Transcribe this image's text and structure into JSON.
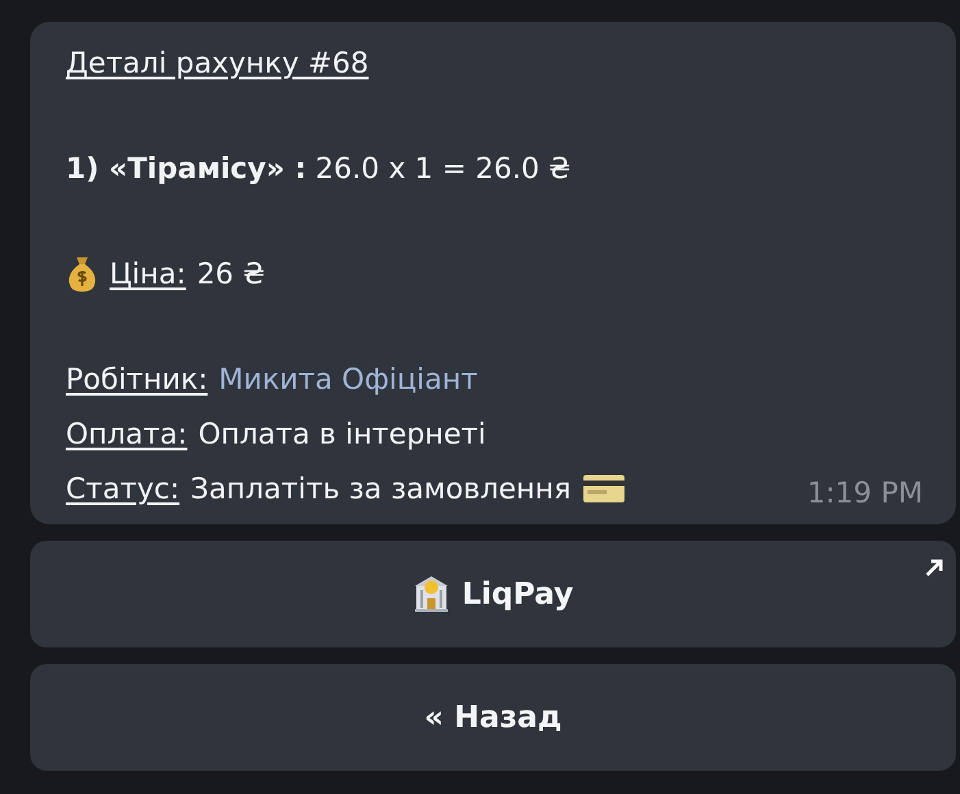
{
  "message": {
    "title": "Деталі рахунку #68",
    "items": [
      "**1) «Тірамісу» :** 26.0 x 1 = 26.0 ₴"
    ],
    "price": {
      "label": "Ціна:",
      "value": "26 ₴"
    },
    "fields": [
      {
        "label": "Робітник:",
        "value": "Микита Офіціант",
        "kind": "link"
      },
      {
        "label": "Оплата:",
        "value": "Оплата в інтернеті",
        "kind": "text"
      },
      {
        "label": "Статус:",
        "value": "Заплатіть за замовлення",
        "kind": "text"
      }
    ],
    "time": "1:19 PM"
  },
  "buttons": [
    {
      "label": "LiqPay",
      "kind": "url"
    },
    {
      "label": "« Назад",
      "kind": "callback"
    }
  ]
}
